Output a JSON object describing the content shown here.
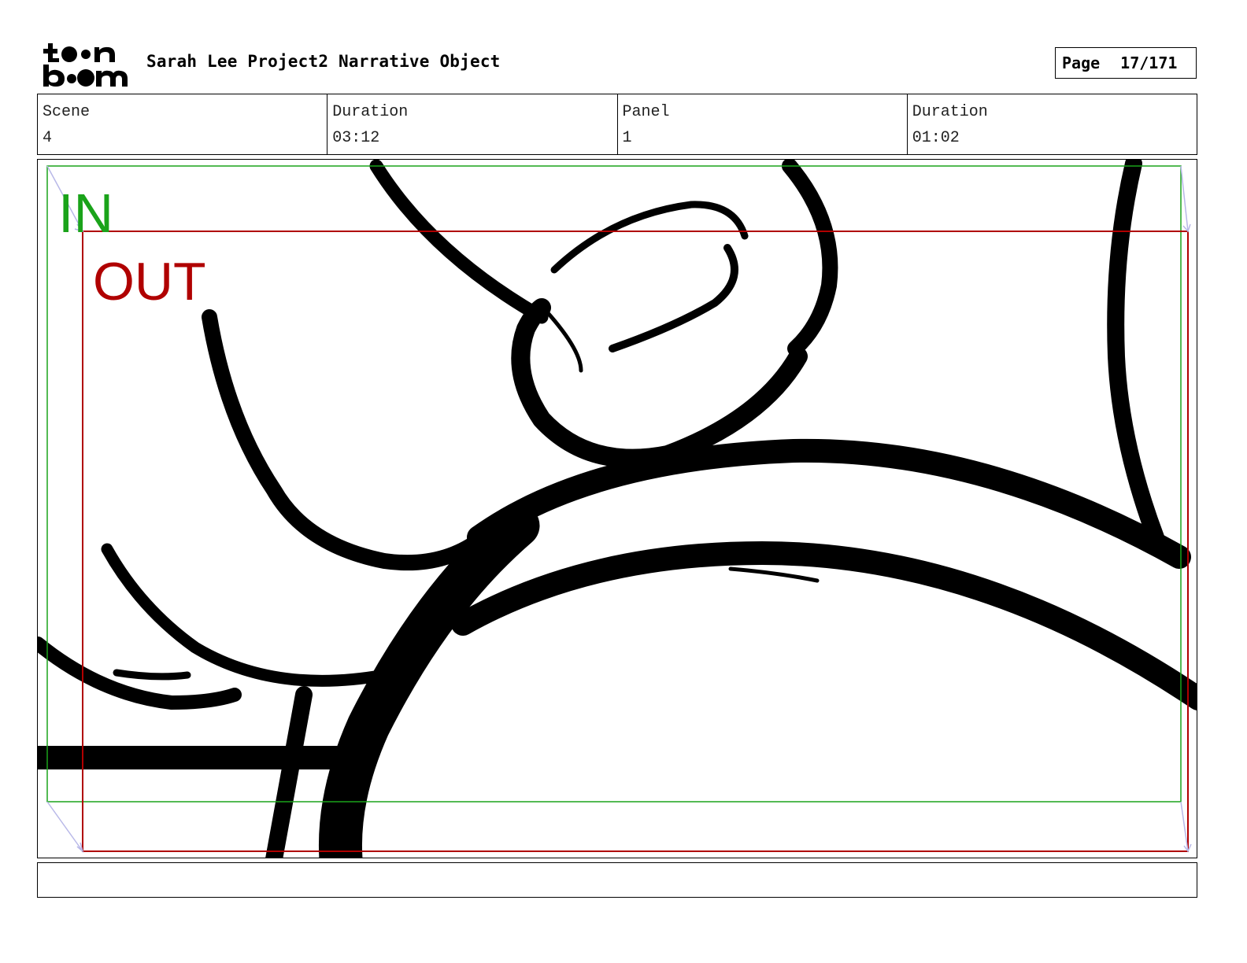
{
  "header": {
    "logo_text_top": "toon",
    "logo_text_bottom": "boom",
    "project_title": "Sarah Lee Project2 Narrative Object",
    "page_label": "Page",
    "page_value": "17/171"
  },
  "info": {
    "scene_label": "Scene",
    "scene_value": "4",
    "scene_duration_label": "Duration",
    "scene_duration_value": "03:12",
    "panel_label": "Panel",
    "panel_value": "1",
    "panel_duration_label": "Duration",
    "panel_duration_value": "01:02"
  },
  "panel": {
    "in_label": "IN",
    "out_label": "OUT",
    "in_color": "#1aa31a",
    "out_color": "#b00000"
  },
  "caption": {
    "text": ""
  }
}
